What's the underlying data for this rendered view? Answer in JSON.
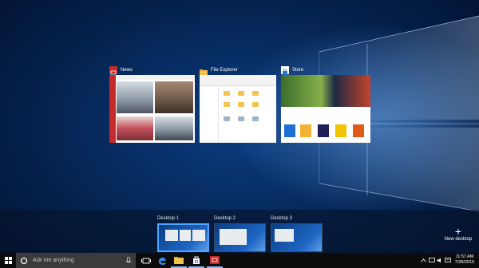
{
  "windows": [
    {
      "title": "News",
      "icon": "news-icon"
    },
    {
      "title": "File Explorer",
      "icon": "file-explorer-icon"
    },
    {
      "title": "Store",
      "icon": "store-icon"
    }
  ],
  "desktops": [
    {
      "label": "Desktop 1",
      "active": true
    },
    {
      "label": "Desktop 2",
      "active": false
    },
    {
      "label": "Desktop 3",
      "active": false
    }
  ],
  "new_desktop": {
    "label": "New desktop",
    "icon": "plus-icon"
  },
  "taskbar": {
    "search_placeholder": "Ask me anything",
    "apps": [
      "task-view-icon",
      "edge-icon",
      "file-explorer-icon",
      "store-icon",
      "news-icon"
    ]
  },
  "tray": {
    "time": "11:57 AM",
    "date": "7/28/2015"
  },
  "colors": {
    "news_red": "#c62b2b",
    "accent": "#4fa3ff",
    "taskbar": "#0c0c0c"
  }
}
